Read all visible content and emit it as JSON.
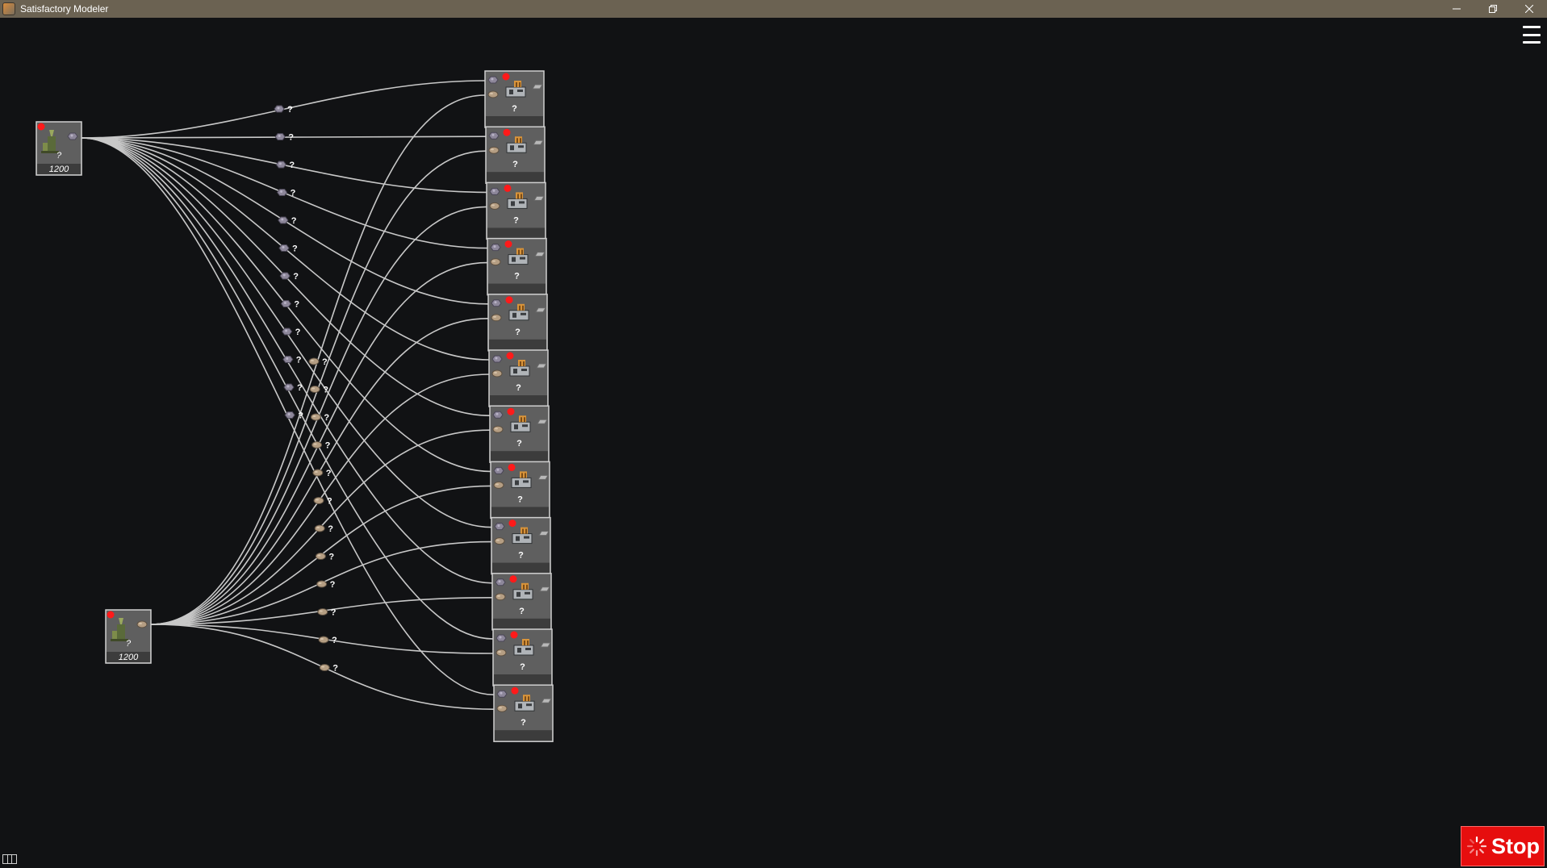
{
  "window": {
    "title": "Satisfactory Modeler",
    "minimize_icon": "minimize-icon",
    "maximize_icon": "restore-icon",
    "close_icon": "close-icon"
  },
  "menu": {
    "icon": "hamburger-menu-icon"
  },
  "stop_button": {
    "label": "Stop",
    "icon": "spinner-icon",
    "color": "#e60e0e"
  },
  "layout_icon": "panel-layout-icon",
  "colors": {
    "background": "#111214",
    "titlebar": "#6b6252",
    "node_fill": "#5f5f5f",
    "connection": "#c8c8c8",
    "status_dot": "#ff1a1a"
  },
  "graph": {
    "miners": [
      {
        "id": "miner-1",
        "resource": "iron-ore-icon",
        "rate": "?",
        "capacity": "1200",
        "status": "error"
      },
      {
        "id": "miner-2",
        "resource": "limestone-icon",
        "rate": "?",
        "capacity": "1200",
        "status": "error"
      }
    ],
    "factories": [
      {
        "label": "?",
        "inputs": [
          "iron-ore-icon",
          "limestone-icon"
        ],
        "output": "steel-ingot-icon",
        "status": "error"
      },
      {
        "label": "?",
        "inputs": [
          "iron-ore-icon",
          "limestone-icon"
        ],
        "output": "steel-ingot-icon",
        "status": "error"
      },
      {
        "label": "?",
        "inputs": [
          "iron-ore-icon",
          "limestone-icon"
        ],
        "output": "steel-ingot-icon",
        "status": "error"
      },
      {
        "label": "?",
        "inputs": [
          "iron-ore-icon",
          "limestone-icon"
        ],
        "output": "steel-ingot-icon",
        "status": "error"
      },
      {
        "label": "?",
        "inputs": [
          "iron-ore-icon",
          "limestone-icon"
        ],
        "output": "steel-ingot-icon",
        "status": "error"
      },
      {
        "label": "?",
        "inputs": [
          "iron-ore-icon",
          "limestone-icon"
        ],
        "output": "steel-ingot-icon",
        "status": "error"
      },
      {
        "label": "?",
        "inputs": [
          "iron-ore-icon",
          "limestone-icon"
        ],
        "output": "steel-ingot-icon",
        "status": "error"
      },
      {
        "label": "?",
        "inputs": [
          "iron-ore-icon",
          "limestone-icon"
        ],
        "output": "steel-ingot-icon",
        "status": "error"
      },
      {
        "label": "?",
        "inputs": [
          "iron-ore-icon",
          "limestone-icon"
        ],
        "output": "steel-ingot-icon",
        "status": "error"
      },
      {
        "label": "?",
        "inputs": [
          "iron-ore-icon",
          "limestone-icon"
        ],
        "output": "steel-ingot-icon",
        "status": "error"
      },
      {
        "label": "?",
        "inputs": [
          "iron-ore-icon",
          "limestone-icon"
        ],
        "output": "steel-ingot-icon",
        "status": "error"
      },
      {
        "label": "?",
        "inputs": [
          "iron-ore-icon",
          "limestone-icon"
        ],
        "output": "steel-ingot-icon",
        "status": "error"
      }
    ],
    "edges_from_miner_1": [
      {
        "to": 0,
        "item": "iron-ore-icon",
        "rate": "?"
      },
      {
        "to": 1,
        "item": "iron-ore-icon",
        "rate": "?"
      },
      {
        "to": 2,
        "item": "iron-ore-icon",
        "rate": "?"
      },
      {
        "to": 3,
        "item": "iron-ore-icon",
        "rate": "?"
      },
      {
        "to": 4,
        "item": "iron-ore-icon",
        "rate": "?"
      },
      {
        "to": 5,
        "item": "iron-ore-icon",
        "rate": "?"
      },
      {
        "to": 6,
        "item": "iron-ore-icon",
        "rate": "?"
      },
      {
        "to": 7,
        "item": "iron-ore-icon",
        "rate": "?"
      },
      {
        "to": 8,
        "item": "iron-ore-icon",
        "rate": "?"
      },
      {
        "to": 9,
        "item": "iron-ore-icon",
        "rate": "?"
      },
      {
        "to": 10,
        "item": "iron-ore-icon",
        "rate": "?"
      },
      {
        "to": 11,
        "item": "iron-ore-icon",
        "rate": "?"
      }
    ],
    "edges_from_miner_2": [
      {
        "to": 0,
        "item": "limestone-icon",
        "rate": "?"
      },
      {
        "to": 1,
        "item": "limestone-icon",
        "rate": "?"
      },
      {
        "to": 2,
        "item": "limestone-icon",
        "rate": "?"
      },
      {
        "to": 3,
        "item": "limestone-icon",
        "rate": "?"
      },
      {
        "to": 4,
        "item": "limestone-icon",
        "rate": "?"
      },
      {
        "to": 5,
        "item": "limestone-icon",
        "rate": "?"
      },
      {
        "to": 6,
        "item": "limestone-icon",
        "rate": "?"
      },
      {
        "to": 7,
        "item": "limestone-icon",
        "rate": "?"
      },
      {
        "to": 8,
        "item": "limestone-icon",
        "rate": "?"
      },
      {
        "to": 9,
        "item": "limestone-icon",
        "rate": "?"
      },
      {
        "to": 10,
        "item": "limestone-icon",
        "rate": "?"
      },
      {
        "to": 11,
        "item": "limestone-icon",
        "rate": "?"
      }
    ]
  }
}
